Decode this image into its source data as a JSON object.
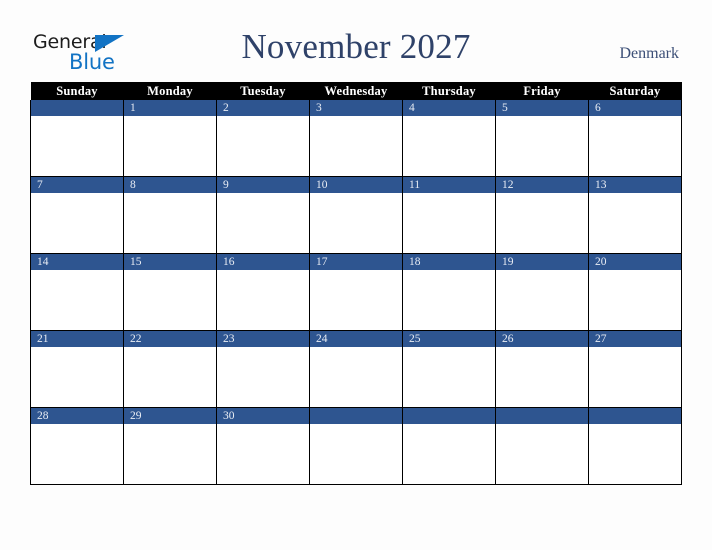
{
  "logo": {
    "word1": "General",
    "word2": "Blue",
    "triangle_color": "#1273c4",
    "word1_color": "#1c1c1c",
    "word2_color": "#1273c4"
  },
  "header": {
    "title": "November 2027",
    "country": "Denmark",
    "title_color": "#2f4269",
    "country_color": "#3c4f77"
  },
  "calendar": {
    "columns": [
      "Sunday",
      "Monday",
      "Tuesday",
      "Wednesday",
      "Thursday",
      "Friday",
      "Saturday"
    ],
    "header_bg": "#000000",
    "header_fg": "#ffffff",
    "date_band_color": "#2e5590",
    "date_text_color": "#e9edf4",
    "cell_bg": "#ffffff",
    "border_color": "#000000",
    "weeks": [
      [
        "",
        "1",
        "2",
        "3",
        "4",
        "5",
        "6"
      ],
      [
        "7",
        "8",
        "9",
        "10",
        "11",
        "12",
        "13"
      ],
      [
        "14",
        "15",
        "16",
        "17",
        "18",
        "19",
        "20"
      ],
      [
        "21",
        "22",
        "23",
        "24",
        "25",
        "26",
        "27"
      ],
      [
        "28",
        "29",
        "30",
        "",
        "",
        "",
        ""
      ]
    ]
  },
  "page": {
    "background": "#fdfdfd"
  }
}
